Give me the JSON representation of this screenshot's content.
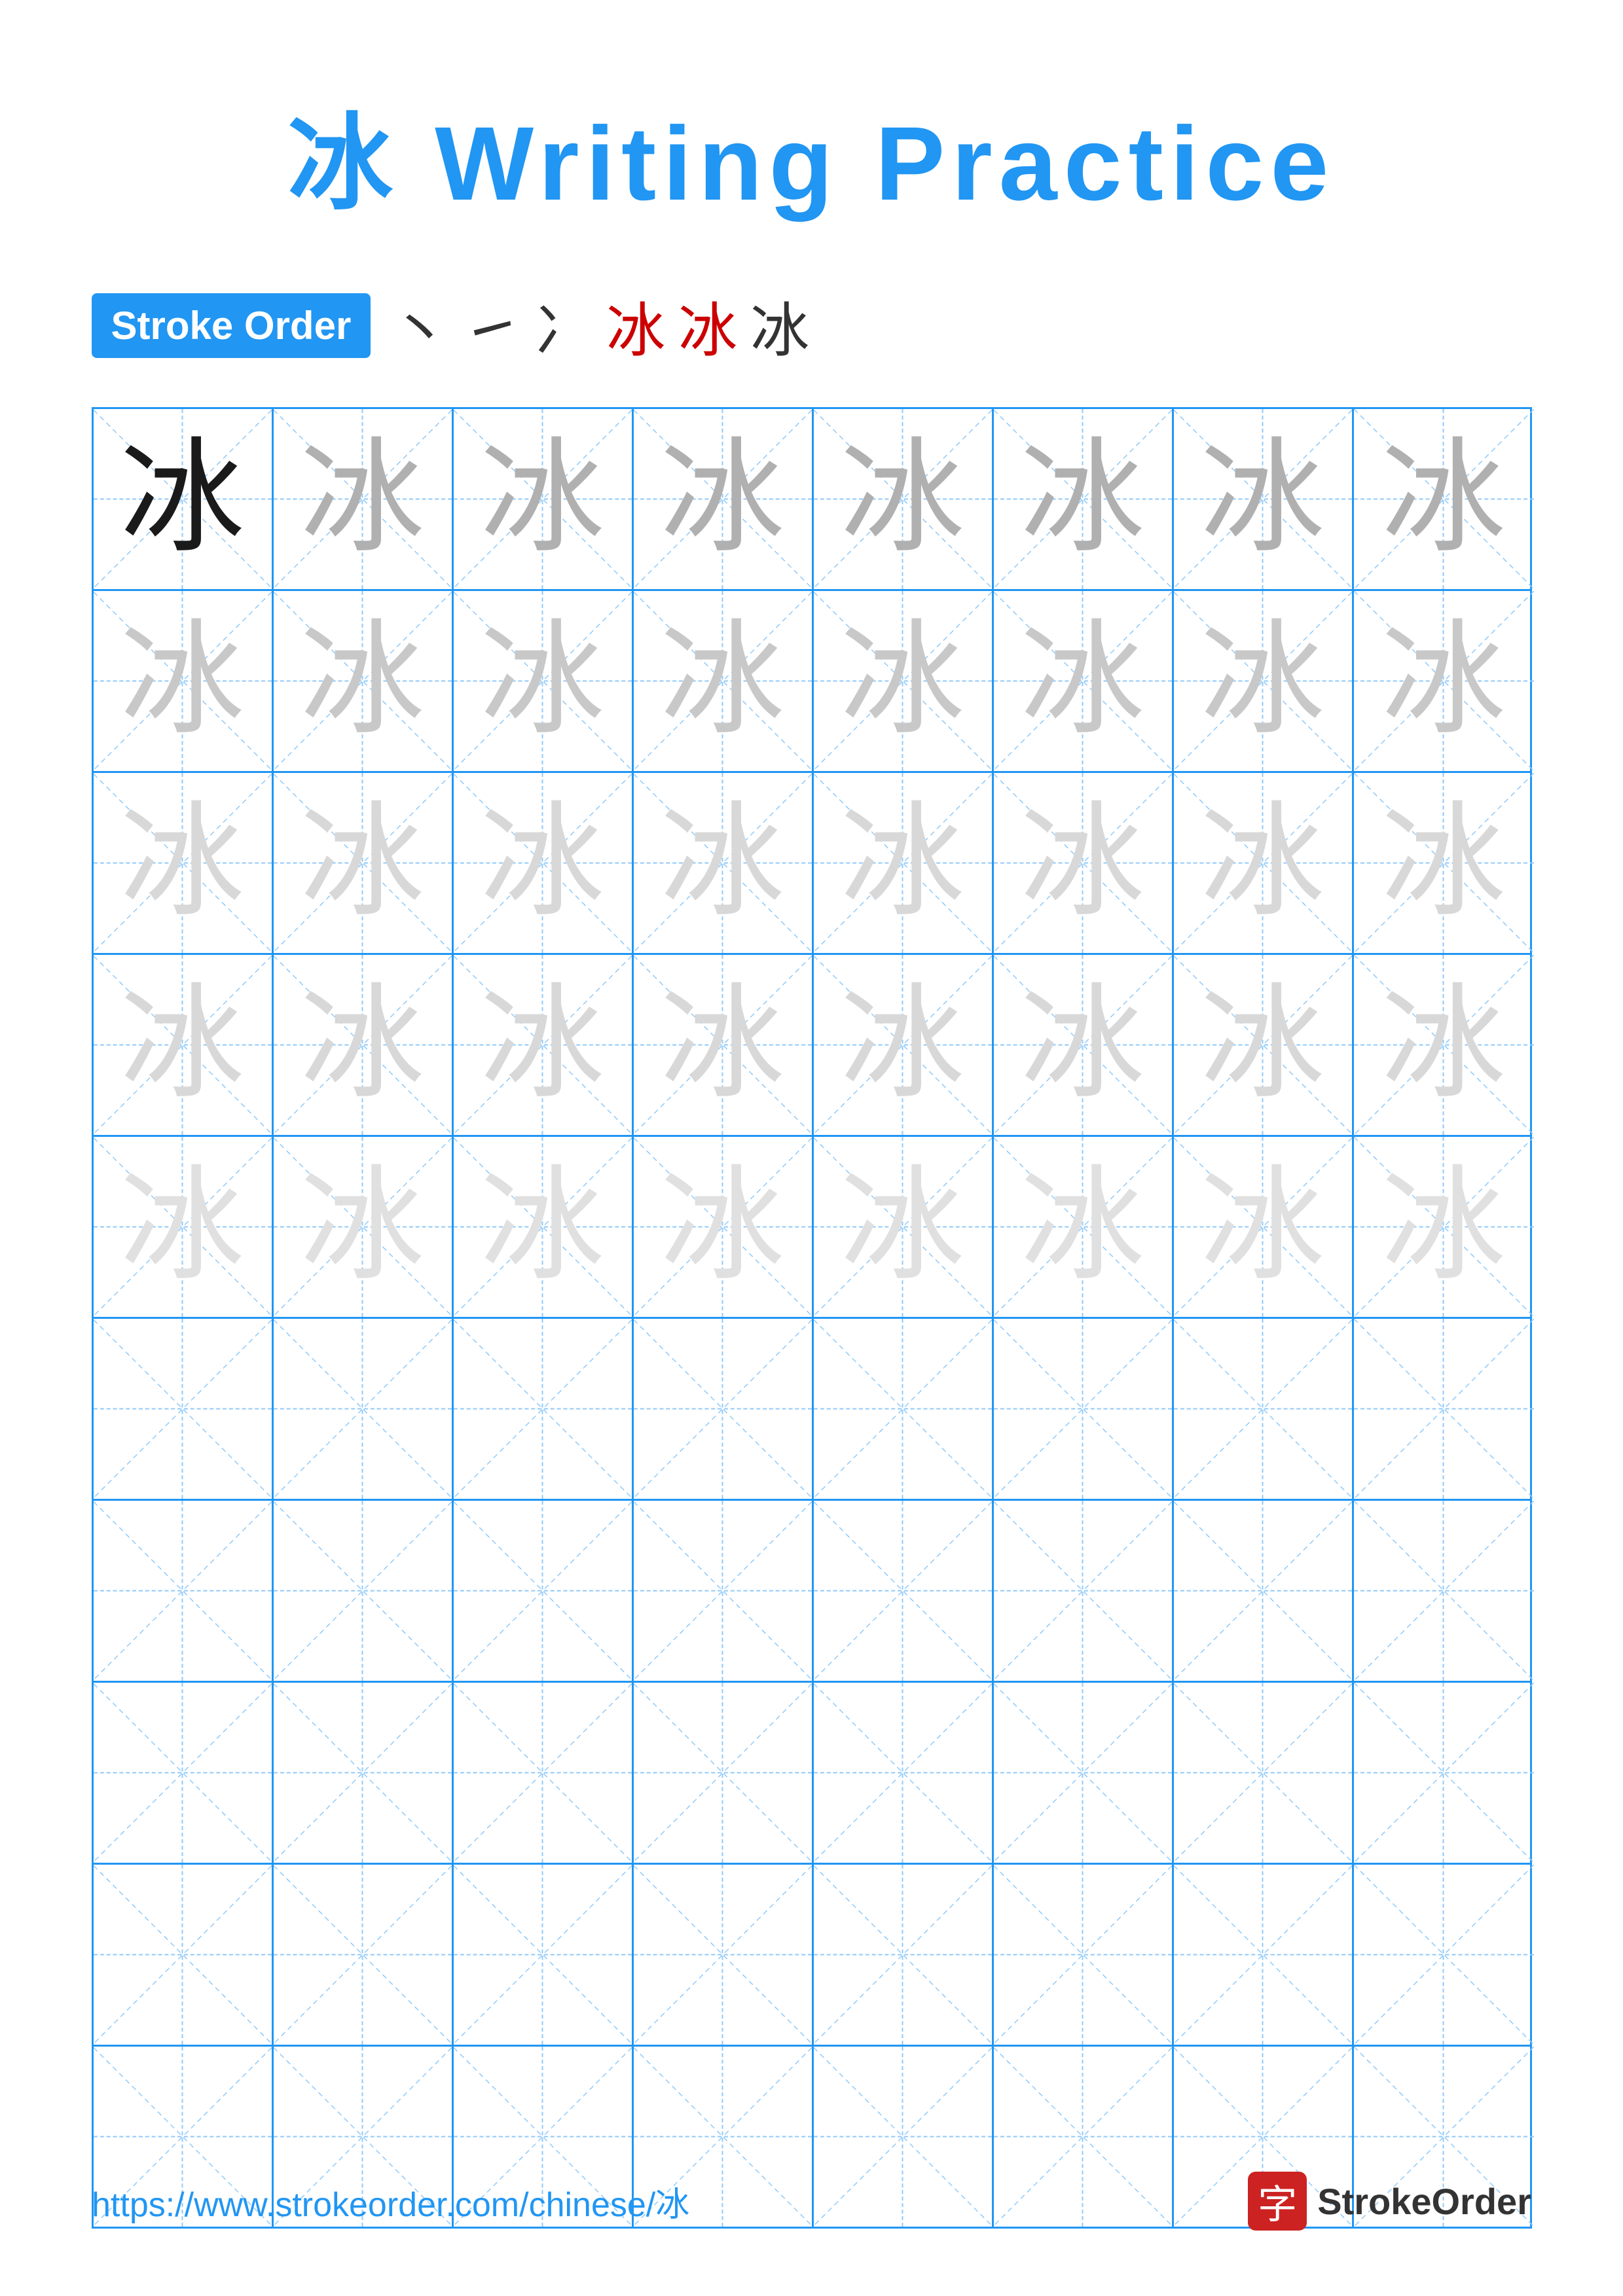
{
  "title": {
    "chinese": "冰",
    "english": " Writing Practice"
  },
  "stroke_order": {
    "badge_label": "Stroke Order",
    "strokes": [
      "丶",
      "㇀",
      "冫",
      "冰̣",
      "冰",
      "冰"
    ]
  },
  "grid": {
    "rows": 10,
    "cols": 8,
    "char": "冰",
    "char_rows_with_guides": 5,
    "char_rows_empty": 5
  },
  "footer": {
    "url": "https://www.strokeorder.com/chinese/冰",
    "logo_char": "字",
    "logo_text": "StrokeOrder"
  },
  "colors": {
    "blue": "#2196F3",
    "light_blue": "#90CAF9",
    "red": "#cc2222",
    "dark": "#1a1a1a",
    "light1": "#b0b0b0",
    "light2": "#c8c8c8",
    "light3": "#d8d8d8",
    "light4": "#e8e8e8"
  }
}
